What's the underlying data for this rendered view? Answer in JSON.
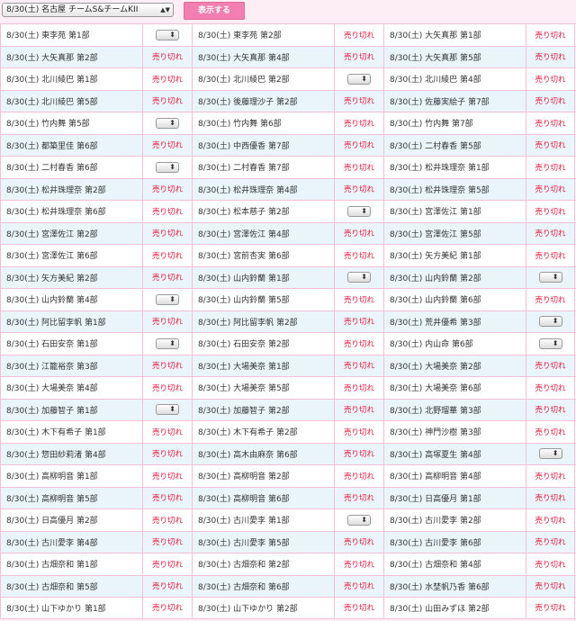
{
  "header": {
    "event_label": "8/30(土) 名古屋 チームS&チームKII",
    "show_button": "表示する"
  },
  "rows": [
    [
      {
        "label": "8/30(土) 東李苑 第1部",
        "status": "select"
      },
      {
        "label": "8/30(土) 東李苑 第2部",
        "status": "soldout"
      },
      {
        "label": "8/30(土) 大矢真那 第1部",
        "status": "soldout"
      }
    ],
    [
      {
        "label": "8/30(土) 大矢真那 第2部",
        "status": "soldout"
      },
      {
        "label": "8/30(土) 大矢真那 第4部",
        "status": "soldout"
      },
      {
        "label": "8/30(土) 大矢真那 第5部",
        "status": "soldout"
      }
    ],
    [
      {
        "label": "8/30(土) 北川綾巴 第1部",
        "status": "soldout"
      },
      {
        "label": "8/30(土) 北川綾巴 第2部",
        "status": "select"
      },
      {
        "label": "8/30(土) 北川綾巴 第4部",
        "status": "soldout"
      }
    ],
    [
      {
        "label": "8/30(土) 北川綾巴 第5部",
        "status": "soldout"
      },
      {
        "label": "8/30(土) 後藤理沙子 第2部",
        "status": "soldout"
      },
      {
        "label": "8/30(土) 佐藤実絵子 第7部",
        "status": "soldout"
      }
    ],
    [
      {
        "label": "8/30(土) 竹内舞 第5部",
        "status": "select"
      },
      {
        "label": "8/30(土) 竹内舞 第6部",
        "status": "soldout"
      },
      {
        "label": "8/30(土) 竹内舞 第7部",
        "status": "soldout"
      }
    ],
    [
      {
        "label": "8/30(土) 都築里佳 第6部",
        "status": "soldout"
      },
      {
        "label": "8/30(土) 中西優香 第7部",
        "status": "soldout"
      },
      {
        "label": "8/30(土) 二村春香 第5部",
        "status": "soldout"
      }
    ],
    [
      {
        "label": "8/30(土) 二村春香 第6部",
        "status": "select"
      },
      {
        "label": "8/30(土) 二村春香 第7部",
        "status": "soldout"
      },
      {
        "label": "8/30(土) 松井珠理奈 第1部",
        "status": "soldout"
      }
    ],
    [
      {
        "label": "8/30(土) 松井珠理奈 第2部",
        "status": "soldout"
      },
      {
        "label": "8/30(土) 松井珠理奈 第4部",
        "status": "soldout"
      },
      {
        "label": "8/30(土) 松井珠理奈 第5部",
        "status": "soldout"
      }
    ],
    [
      {
        "label": "8/30(土) 松井珠理奈 第6部",
        "status": "soldout"
      },
      {
        "label": "8/30(土) 松本慈子 第2部",
        "status": "select"
      },
      {
        "label": "8/30(土) 宮澤佐江 第1部",
        "status": "soldout"
      }
    ],
    [
      {
        "label": "8/30(土) 宮澤佐江 第2部",
        "status": "soldout"
      },
      {
        "label": "8/30(土) 宮澤佐江 第4部",
        "status": "soldout"
      },
      {
        "label": "8/30(土) 宮澤佐江 第5部",
        "status": "soldout"
      }
    ],
    [
      {
        "label": "8/30(土) 宮澤佐江 第6部",
        "status": "soldout"
      },
      {
        "label": "8/30(土) 宮前杏実 第6部",
        "status": "soldout"
      },
      {
        "label": "8/30(土) 矢方美紀 第1部",
        "status": "soldout"
      }
    ],
    [
      {
        "label": "8/30(土) 矢方美紀 第2部",
        "status": "soldout"
      },
      {
        "label": "8/30(土) 山内鈴蘭 第1部",
        "status": "select"
      },
      {
        "label": "8/30(土) 山内鈴蘭 第2部",
        "status": "select"
      }
    ],
    [
      {
        "label": "8/30(土) 山内鈴蘭 第4部",
        "status": "select"
      },
      {
        "label": "8/30(土) 山内鈴蘭 第5部",
        "status": "soldout"
      },
      {
        "label": "8/30(土) 山内鈴蘭 第6部",
        "status": "soldout"
      }
    ],
    [
      {
        "label": "8/30(土) 阿比留李帆 第1部",
        "status": "soldout"
      },
      {
        "label": "8/30(土) 阿比留李帆 第2部",
        "status": "soldout"
      },
      {
        "label": "8/30(土) 荒井優希 第3部",
        "status": "select"
      }
    ],
    [
      {
        "label": "8/30(土) 石田安奈 第1部",
        "status": "select"
      },
      {
        "label": "8/30(土) 石田安奈 第2部",
        "status": "soldout"
      },
      {
        "label": "8/30(土) 内山命 第6部",
        "status": "select"
      }
    ],
    [
      {
        "label": "8/30(土) 江籠裕奈 第3部",
        "status": "soldout"
      },
      {
        "label": "8/30(土) 大場美奈 第1部",
        "status": "soldout"
      },
      {
        "label": "8/30(土) 大場美奈 第2部",
        "status": "soldout"
      }
    ],
    [
      {
        "label": "8/30(土) 大場美奈 第4部",
        "status": "soldout"
      },
      {
        "label": "8/30(土) 大場美奈 第5部",
        "status": "soldout"
      },
      {
        "label": "8/30(土) 大場美奈 第6部",
        "status": "soldout"
      }
    ],
    [
      {
        "label": "8/30(土) 加藤智子 第1部",
        "status": "select"
      },
      {
        "label": "8/30(土) 加藤智子 第2部",
        "status": "soldout"
      },
      {
        "label": "8/30(土) 北野瑠華 第3部",
        "status": "soldout"
      }
    ],
    [
      {
        "label": "8/30(土) 木下有希子 第1部",
        "status": "soldout"
      },
      {
        "label": "8/30(土) 木下有希子 第2部",
        "status": "soldout"
      },
      {
        "label": "8/30(土) 神門沙樹 第3部",
        "status": "soldout"
      }
    ],
    [
      {
        "label": "8/30(土) 惣田紗莉渚 第4部",
        "status": "soldout"
      },
      {
        "label": "8/30(土) 高木由麻奈 第6部",
        "status": "soldout"
      },
      {
        "label": "8/30(土) 高塚夏生 第4部",
        "status": "select"
      }
    ],
    [
      {
        "label": "8/30(土) 高柳明音 第1部",
        "status": "soldout"
      },
      {
        "label": "8/30(土) 高柳明音 第2部",
        "status": "soldout"
      },
      {
        "label": "8/30(土) 高柳明音 第4部",
        "status": "soldout"
      }
    ],
    [
      {
        "label": "8/30(土) 高柳明音 第5部",
        "status": "soldout"
      },
      {
        "label": "8/30(土) 高柳明音 第6部",
        "status": "soldout"
      },
      {
        "label": "8/30(土) 日高優月 第1部",
        "status": "soldout"
      }
    ],
    [
      {
        "label": "8/30(土) 日高優月 第2部",
        "status": "soldout"
      },
      {
        "label": "8/30(土) 古川愛李 第1部",
        "status": "select"
      },
      {
        "label": "8/30(土) 古川愛李 第2部",
        "status": "soldout"
      }
    ],
    [
      {
        "label": "8/30(土) 古川愛李 第4部",
        "status": "soldout"
      },
      {
        "label": "8/30(土) 古川愛李 第5部",
        "status": "soldout"
      },
      {
        "label": "8/30(土) 古川愛李 第6部",
        "status": "soldout"
      }
    ],
    [
      {
        "label": "8/30(土) 古畑奈和 第1部",
        "status": "soldout"
      },
      {
        "label": "8/30(土) 古畑奈和 第2部",
        "status": "soldout"
      },
      {
        "label": "8/30(土) 古畑奈和 第4部",
        "status": "soldout"
      }
    ],
    [
      {
        "label": "8/30(土) 古畑奈和 第5部",
        "status": "soldout"
      },
      {
        "label": "8/30(土) 古畑奈和 第6部",
        "status": "soldout"
      },
      {
        "label": "8/30(土) 水埜帆乃香 第6部",
        "status": "soldout"
      }
    ],
    [
      {
        "label": "8/30(土) 山下ゆかり 第1部",
        "status": "soldout"
      },
      {
        "label": "8/30(土) 山下ゆかり 第2部",
        "status": "soldout"
      },
      {
        "label": "8/30(土) 山田みずほ 第2部",
        "status": "soldout"
      }
    ]
  ],
  "soldout_label": "売り切れ",
  "colors": {
    "background": "#fdeef5",
    "row_alt": "#e9f5fb",
    "soldout_text": "#e8153b",
    "button": "#f37fb0",
    "grid_line": "#f1c2d7"
  }
}
